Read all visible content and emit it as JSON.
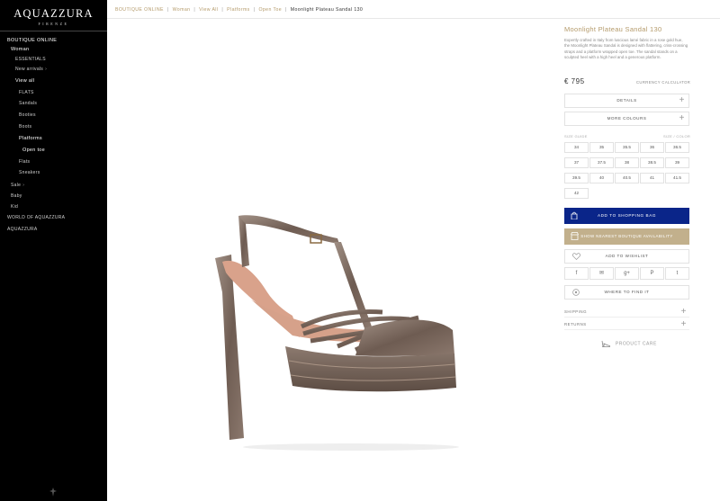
{
  "brand": {
    "name": "AQUAZZURA",
    "sub": "FIRENZE"
  },
  "sidebar": {
    "items": [
      {
        "label": "BOUTIQUE ONLINE",
        "level": 0,
        "bold": true
      },
      {
        "label": "Woman",
        "level": 1,
        "bold": true
      },
      {
        "label": "ESSENTIALS",
        "level": 2
      },
      {
        "label": "New arrivals",
        "level": 2,
        "arrow": "›"
      },
      {
        "label": "View all",
        "level": 2,
        "bold": true
      },
      {
        "label": "FLATS",
        "level": 3
      },
      {
        "label": "Sandals",
        "level": 3
      },
      {
        "label": "Booties",
        "level": 3
      },
      {
        "label": "Boots",
        "level": 3
      },
      {
        "label": "Platforms",
        "level": 3,
        "bold": true
      },
      {
        "label": "Open toe",
        "level": 4,
        "bold": true
      },
      {
        "label": "Flats",
        "level": 3
      },
      {
        "label": "Sneakers",
        "level": 3
      },
      {
        "label": "Sale",
        "level": 1,
        "arrow": "›"
      },
      {
        "label": "Baby",
        "level": 1
      },
      {
        "label": "Kid",
        "level": 1
      },
      {
        "label": "WORLD OF AQUAZZURA",
        "level": 0
      },
      {
        "label": "AQUAZZURA",
        "level": 0
      }
    ]
  },
  "breadcrumb": {
    "items": [
      "BOUTIQUE ONLINE",
      "Woman",
      "View All",
      "Platforms",
      "Open Toe"
    ],
    "current": "Moonlight Plateau Sandal 130"
  },
  "product": {
    "title": "Moonlight Plateau Sandal 130",
    "description": "Expertly crafted in Italy from luscious lamé fabric in a rose gold hue, the Moonlight Plateau Sandal is designed with flattering, criss-crossing straps and a platform wrapped open toe. The sandal stands on a sculpted heel with a high heel and a generous platform.",
    "price": "€ 795",
    "currency_calculator": "CURRENCY CALCULATOR",
    "details_label": "DETAILS",
    "more_colours_label": "MORE COLOURS",
    "size_guide_label": "SIZE GUIDE",
    "size_conversion_label": "SIZE / COLOR",
    "sizes": [
      "34",
      "35",
      "35.5",
      "36",
      "36.5",
      "37",
      "37.5",
      "38",
      "38.5",
      "39",
      "39.5",
      "40",
      "40.5",
      "41",
      "41.5",
      "42"
    ],
    "add_to_bag": "ADD TO SHOPPING BAG",
    "availability": "SHOW NEAREST BOUTIQUE AVAILABILITY",
    "wishlist": "ADD TO WISHLIST",
    "share": [
      "facebook-icon",
      "mail-icon",
      "google-plus-icon",
      "pinterest-icon",
      "twitter-icon"
    ],
    "share_glyphs": [
      "f",
      "✉",
      "g+",
      "P",
      "t"
    ],
    "where_to_find": "WHERE TO FIND IT",
    "shipping": "SHIPPING",
    "returns": "RETURNS",
    "product_care": "PRODUCT CARE"
  },
  "colors": {
    "accent": "#b49a6a",
    "bag_button": "#0a2589",
    "availability_button": "#c2b08c"
  }
}
